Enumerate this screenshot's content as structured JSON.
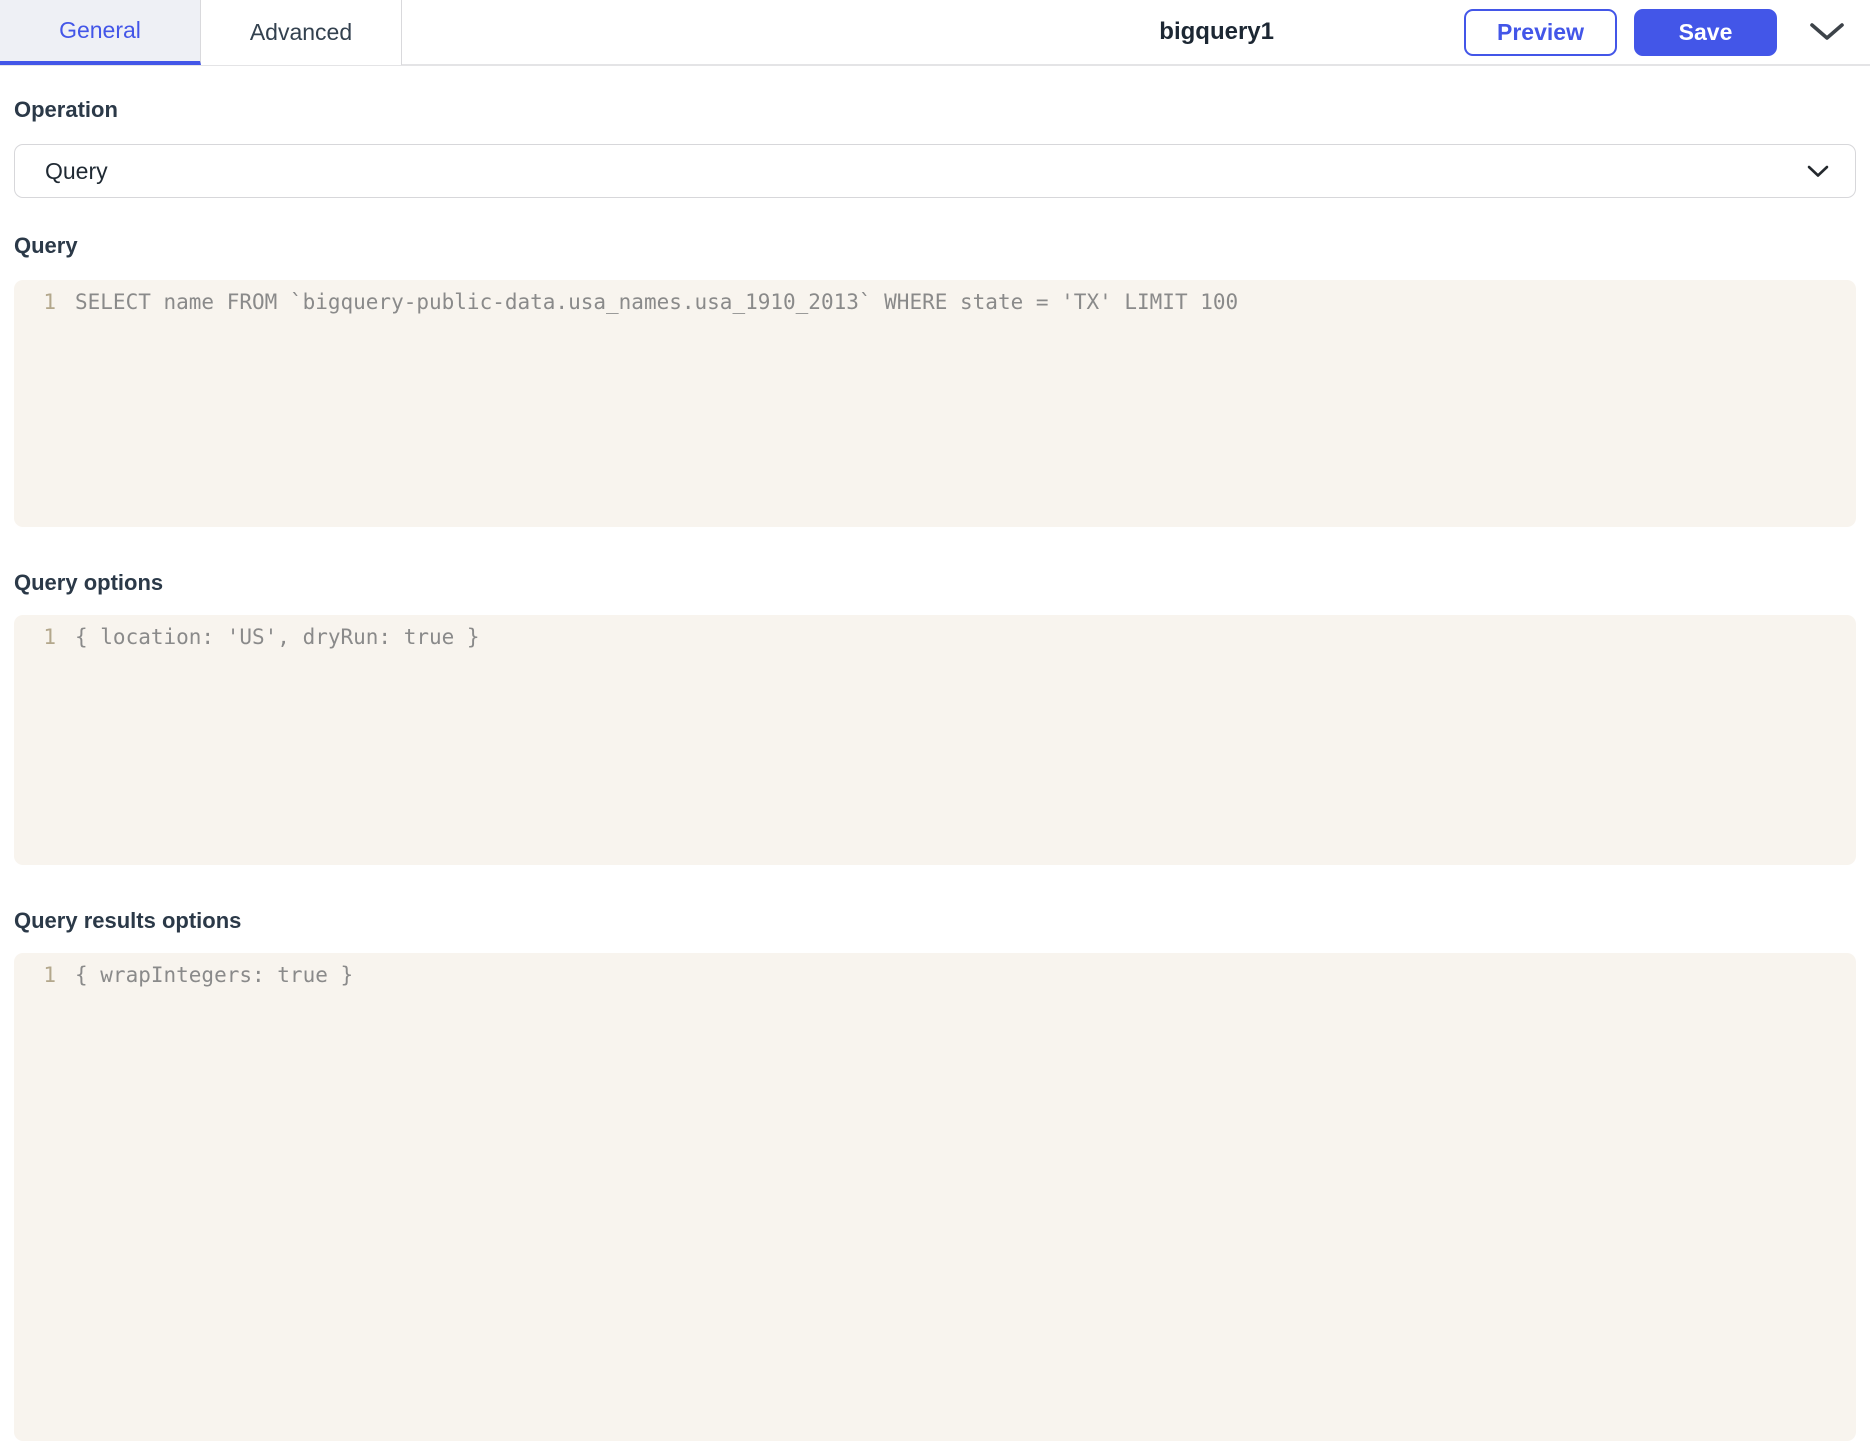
{
  "header": {
    "tabs": {
      "general": "General",
      "advanced": "Advanced"
    },
    "title": "bigquery1",
    "buttons": {
      "preview": "Preview",
      "save": "Save"
    },
    "icons": {
      "more": "chevron-down-icon"
    }
  },
  "operation": {
    "label": "Operation",
    "value": "Query",
    "icon": "chevron-down-icon"
  },
  "query": {
    "label": "Query",
    "line_number": "1",
    "code": "SELECT name FROM `bigquery-public-data.usa_names.usa_1910_2013` WHERE state = 'TX' LIMIT 100"
  },
  "query_options": {
    "label": "Query options",
    "line_number": "1",
    "code": "{ location: 'US', dryRun: true }"
  },
  "query_results_options": {
    "label": "Query results options",
    "line_number": "1",
    "code": "{ wrapIntegers: true }"
  },
  "colors": {
    "accent_blue": "#4356e8",
    "tab_active_bg": "#eef0f5",
    "tab_text": "#33414f",
    "editor_bg": "#f8f4ee",
    "line_number": "#b3a78c",
    "code_text": "#8a8a8a",
    "heading_text": "#2b3948",
    "title_text": "#1c2733",
    "header_border": "#e4e4e6",
    "select_border": "#d7d7da"
  }
}
